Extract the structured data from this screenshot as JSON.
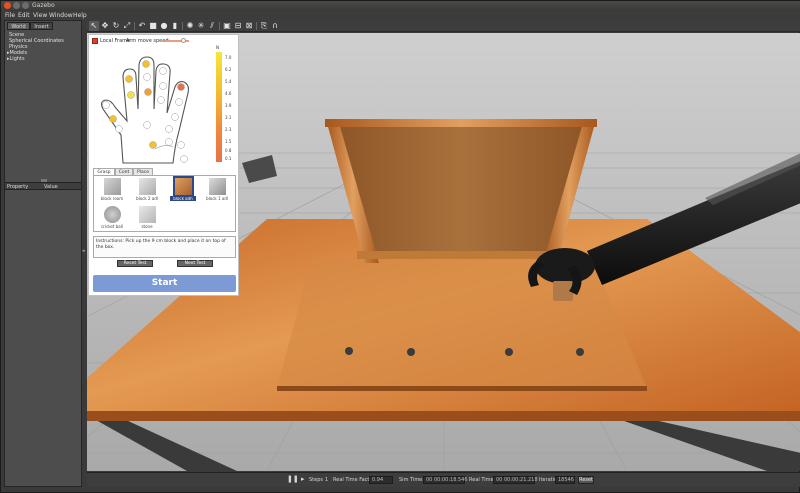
{
  "app": {
    "title": "Gazebo"
  },
  "menubar": {
    "items": [
      "File",
      "Edit",
      "View",
      "Window",
      "Help"
    ]
  },
  "left_panel": {
    "tabs": [
      "World",
      "Insert"
    ],
    "tree": [
      "Scene",
      "Spherical Coordinates",
      "Physics",
      "Models",
      "Lights"
    ],
    "props": {
      "property_header": "Property",
      "value_header": "Value"
    }
  },
  "toolbar": {
    "icons": [
      "arrow-icon",
      "translate-icon",
      "rotate-icon",
      "scale-icon",
      "undo-icon",
      "box-icon",
      "sphere-icon",
      "cylinder-icon",
      "point-light-icon",
      "spot-light-icon",
      "directional-light-icon",
      "screenshot-icon",
      "align-icon",
      "snap-icon",
      "record-icon",
      "headphones-icon"
    ]
  },
  "overlay": {
    "local_frame_label": "Local Frame",
    "arm_speed_label": "Arm move speed:",
    "arm_speed_level": 0.75,
    "legend": {
      "unit": "N",
      "ticks": [
        "7.0",
        "6.2",
        "5.4",
        "4.6",
        "3.9",
        "3.1",
        "2.3",
        "1.5",
        "0.8",
        "0.1"
      ]
    },
    "tabs": [
      "Grasp",
      "Cont",
      "Place"
    ],
    "objects": [
      {
        "label": "block room",
        "selected": false
      },
      {
        "label": "block 2 adl",
        "selected": false
      },
      {
        "label": "block adh",
        "selected": true
      },
      {
        "label": "block 1 adl",
        "selected": false
      },
      {
        "label": "cricket ball",
        "selected": false
      },
      {
        "label": "stone",
        "selected": false
      }
    ],
    "instructions": "Instructions: Pick up the 9 cm block and place it on top of the box.",
    "reset_test_label": "Reset Test",
    "next_test_label": "Next Test",
    "start_label": "Start"
  },
  "bottombar": {
    "steps_label": "Steps",
    "steps_value": "1",
    "rtf_label": "Real Time Factor:",
    "rtf_value": "0.94",
    "sim_time_label": "Sim Time:",
    "sim_time_value": "00 00:00:18.546",
    "real_time_label": "Real Time:",
    "real_time_value": "00 00:00:21.218",
    "iterations_label": "Iterations:",
    "iterations_value": "18546",
    "reset_label": "Reset"
  },
  "colors": {
    "table_wood": "#d77f35",
    "box_wood": "#b87a3a",
    "start_button": "#7c9ad6",
    "local_frame_check": "#d9442a"
  }
}
